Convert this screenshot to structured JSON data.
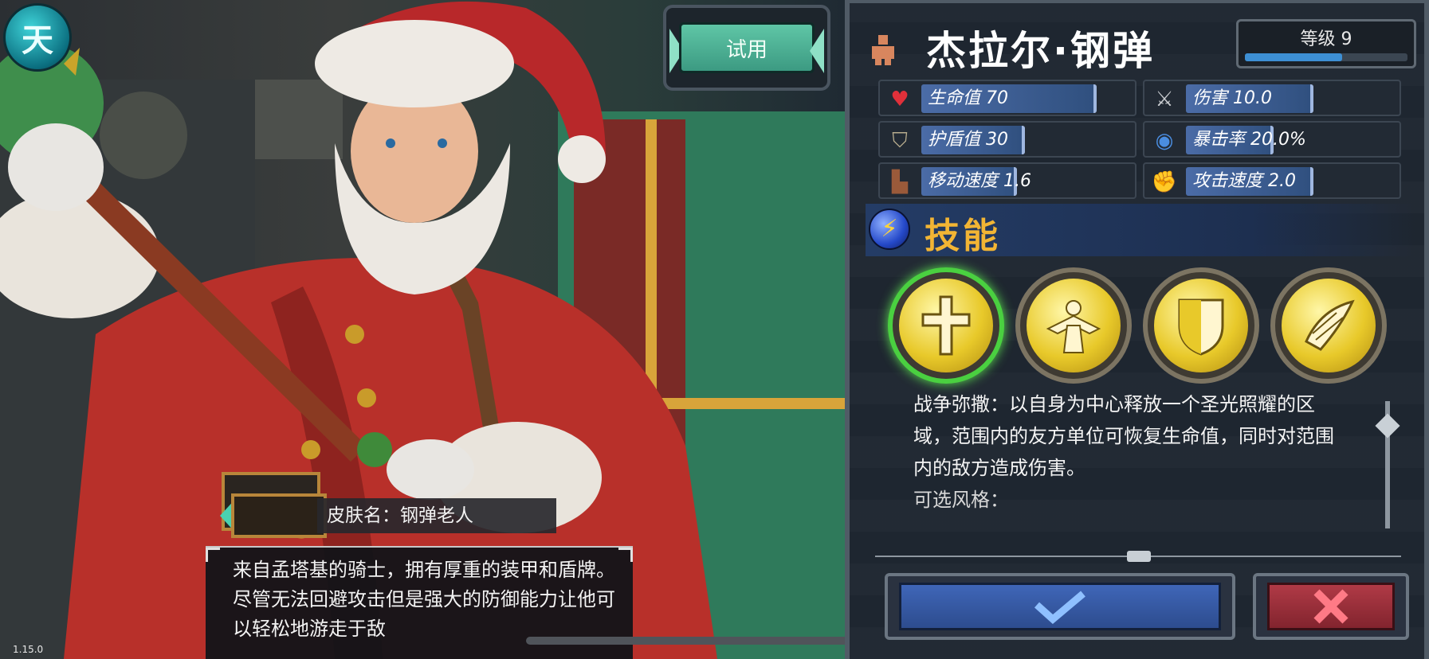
{
  "corner_logo": {
    "glyph": "天"
  },
  "trial_button": {
    "label": "试用"
  },
  "skin": {
    "label": "皮肤名：钢弹老人",
    "description": "来自孟塔基的骑士，拥有厚重的装甲和盾牌。尽管无法回避攻击但是强大的防御能力让他可以轻松地游走于敌"
  },
  "version": "1.15.0",
  "hero": {
    "name": "杰拉尔·钢弹",
    "level_label": "等级 9",
    "level_progress": 0.6
  },
  "stats": [
    {
      "label": "生命值 70",
      "icon": "heart-icon"
    },
    {
      "label": "伤害 10.0",
      "icon": "sword-icon"
    },
    {
      "label": "护盾值 30",
      "icon": "shield-icon"
    },
    {
      "label": "暴击率 20.0%",
      "icon": "eye-icon"
    },
    {
      "label": "移动速度 1.6",
      "icon": "boot-icon"
    },
    {
      "label": "攻击速度 2.0",
      "icon": "fist-icon"
    }
  ],
  "skills_title": "技能",
  "skills": [
    {
      "icon": "cross-icon",
      "selected": true
    },
    {
      "icon": "angel-icon",
      "selected": false
    },
    {
      "icon": "shield-crest-icon",
      "selected": false
    },
    {
      "icon": "scroll-wing-icon",
      "selected": false
    }
  ],
  "skill_description": "战争弥撒：以自身为中心释放一个圣光照耀的区域，范围内的友方单位可恢复生命值，同时对范围内的敌方造成伤害。",
  "skill_description_extra": "可选风格："
}
